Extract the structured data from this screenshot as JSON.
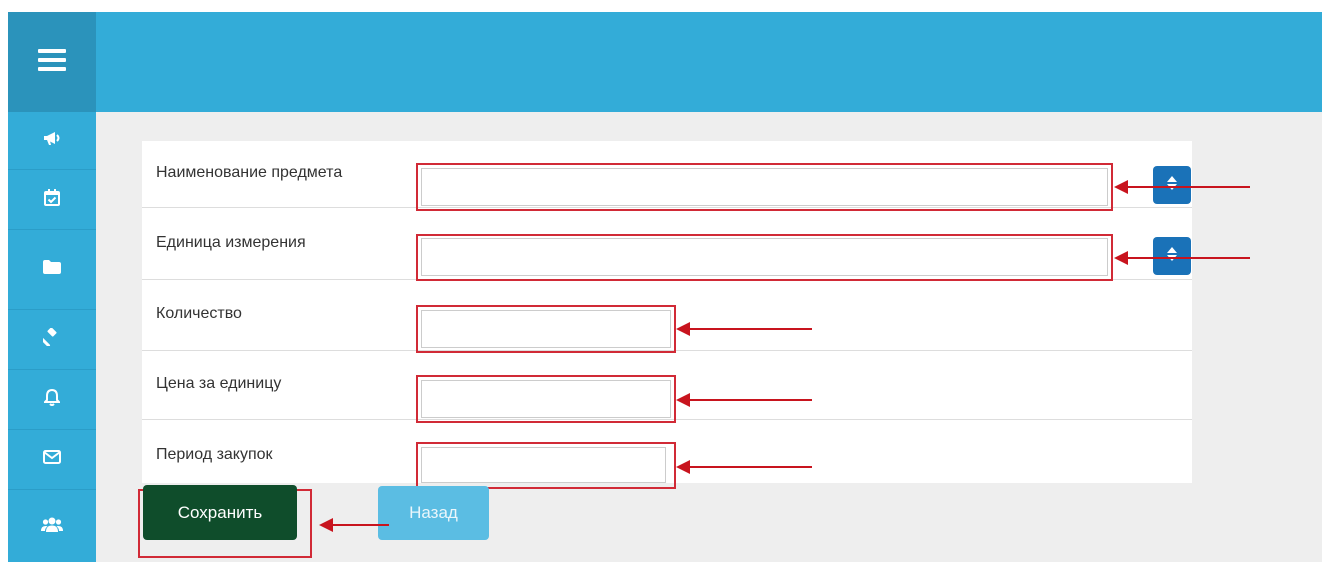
{
  "header": {
    "menu_icon": "hamburger-menu-icon"
  },
  "sidebar": {
    "items": [
      {
        "icon": "bullhorn-icon"
      },
      {
        "icon": "calendar-check-icon"
      },
      {
        "icon": "folder-icon"
      },
      {
        "icon": "gavel-icon"
      },
      {
        "icon": "bell-icon"
      },
      {
        "icon": "envelope-icon"
      },
      {
        "icon": "users-icon"
      }
    ]
  },
  "form": {
    "fields": [
      {
        "label": "Наименование предмета",
        "value": "",
        "has_stepper": true
      },
      {
        "label": "Единица измерения",
        "value": "",
        "has_stepper": true
      },
      {
        "label": "Количество",
        "value": ""
      },
      {
        "label": "Цена за единицу",
        "value": ""
      },
      {
        "label": "Период закупок",
        "value": ""
      }
    ],
    "save_label": "Сохранить",
    "back_label": "Назад"
  },
  "colors": {
    "header": "#33acd8",
    "menu_button": "#2b93bb",
    "stepper": "#1a72b8",
    "save_button": "#0f4d2b",
    "back_button": "#5bbde3",
    "annotation": "#c8141e"
  }
}
